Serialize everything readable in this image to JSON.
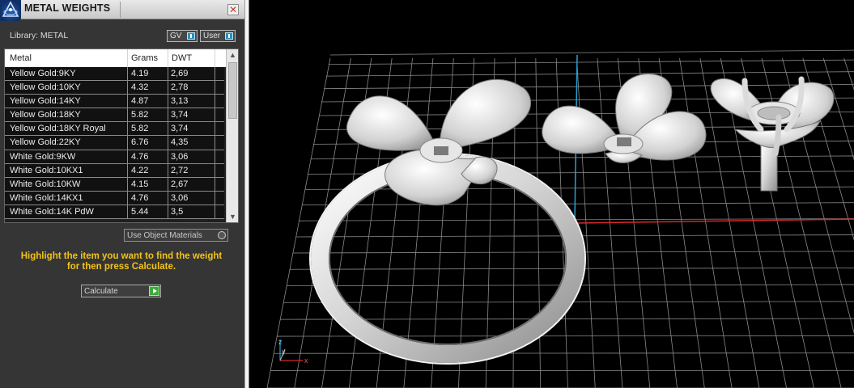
{
  "window": {
    "title": "METAL WEIGHTS",
    "close_glyph": "✕"
  },
  "library": {
    "label": "Library: METAL"
  },
  "toggles": {
    "gv_label": "GV",
    "user_label": "User"
  },
  "table": {
    "columns": [
      "Metal",
      "Grams",
      "DWT"
    ],
    "rows": [
      [
        "Yellow Gold:9KY",
        "4.19",
        "2,69"
      ],
      [
        "Yellow Gold:10KY",
        "4.32",
        "2,78"
      ],
      [
        "Yellow Gold:14KY",
        "4.87",
        "3,13"
      ],
      [
        "Yellow Gold:18KY",
        "5.82",
        "3,74"
      ],
      [
        "Yellow Gold:18KY Royal",
        "5.82",
        "3,74"
      ],
      [
        "Yellow Gold:22KY",
        "6.76",
        "4,35"
      ],
      [
        "White Gold:9KW",
        "4.76",
        "3,06"
      ],
      [
        "White Gold:10KX1",
        "4.22",
        "2,72"
      ],
      [
        "White Gold:10KW",
        "4.15",
        "2,67"
      ],
      [
        "White Gold:14KX1",
        "4.76",
        "3,06"
      ],
      [
        "White Gold:14K PdW",
        "5.44",
        "3,5"
      ]
    ]
  },
  "options": {
    "use_object_materials_label": "Use Object Materials"
  },
  "instructions": {
    "line1": "Highlight the item you want to find the weight",
    "line2": "for then press Calculate."
  },
  "actions": {
    "calculate_label": "Calculate"
  },
  "viewport": {
    "axis_labels": {
      "x": "x",
      "y": "y",
      "z": "z"
    },
    "colors": {
      "grid": "#8a8a8a",
      "x_axis": "#d62b2b",
      "y_axis": "#2a9fd0",
      "model": "#d9d9d9"
    }
  },
  "colors": {
    "panel_bg": "#353535",
    "instruction_text": "#f3c319",
    "calculate_arrow": "#3eaa3a",
    "toggle_knob": "#2b8fbf"
  }
}
